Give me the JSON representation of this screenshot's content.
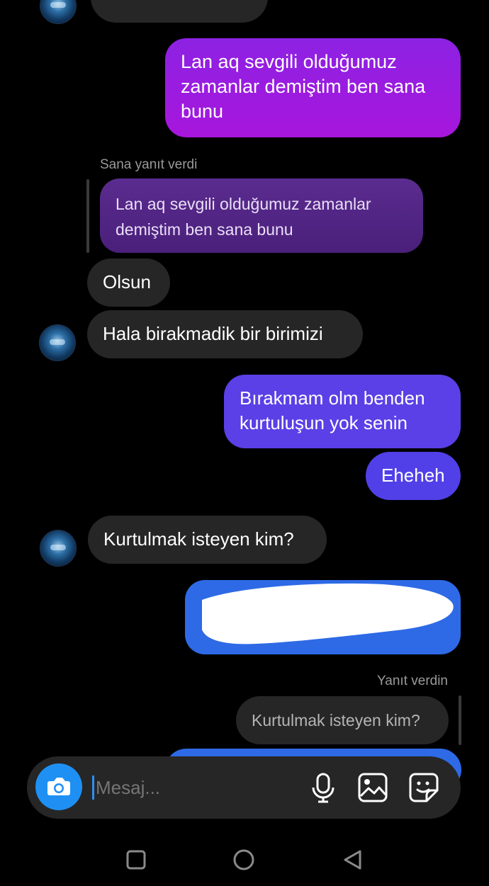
{
  "messages": {
    "m1": "Lan aq sevgili olduğumuz zamanlar demiştim ben sana bunu",
    "reply_label_1": "Sana yanıt verdi",
    "quoted_1": "Lan aq sevgili olduğumuz zamanlar demiştim ben sana bunu",
    "m2": "Olsun",
    "m3": "Hala birakmadik bir birimizi",
    "m4": "Bırakmam olm benden kurtuluşun yok senin",
    "m5": "Eheheh",
    "m6": "Kurtulmak isteyen kim?",
    "reply_label_2": "Yanıt verdin",
    "quoted_2": "Kurtulmak isteyen kim?"
  },
  "composer": {
    "placeholder": "Mesaj..."
  },
  "icons": {
    "camera": "camera-icon",
    "mic": "microphone-icon",
    "gallery": "image-icon",
    "sticker": "sticker-icon"
  },
  "colors": {
    "purple": "#9a1ee0",
    "violet": "#5b3ee8",
    "blue": "#2f6fe6",
    "received": "#262626"
  }
}
